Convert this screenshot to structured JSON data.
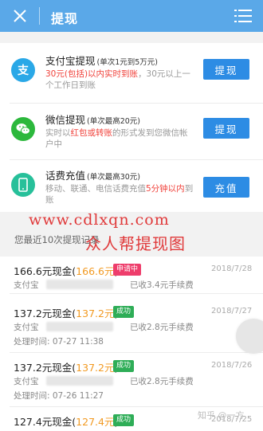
{
  "header": {
    "title": "提现"
  },
  "methods": [
    {
      "name": "支付宝提现",
      "limit": "(单次1元到5万元)",
      "desc_highlight": "30元(包括)以内实时到账",
      "desc_rest": "，30元以上一个工作日到账",
      "button": "提现",
      "icon": "alipay-icon",
      "color": "#2aa8e7"
    },
    {
      "name": "微信提现",
      "limit": "(单次最高20元)",
      "desc_pre": "实时以",
      "desc_highlight": "红包或转账",
      "desc_rest": "的形式发到您微信帐户中",
      "button": "提现",
      "icon": "wechat-icon",
      "color": "#2cb83c"
    },
    {
      "name": "话费充值",
      "limit": "(单次最高30元)",
      "desc_pre": "移动、联通、电信话费充值",
      "desc_highlight": "5分钟以内",
      "desc_rest": "到账",
      "button": "充值",
      "icon": "phone-icon",
      "color": "#27c09a"
    }
  ],
  "watermark": {
    "url": "www.cdlxqn.com",
    "text": "众人帮提现图"
  },
  "recent_title": "您最近10次提现记录",
  "records": [
    {
      "amount": "166.6元现金(",
      "amount_value": "166.6元",
      "amount_close": ")",
      "status": "申请中",
      "status_type": "pending",
      "date": "2018/7/28",
      "account": "支付宝",
      "fee": "已收3.4元手续费",
      "time": ""
    },
    {
      "amount": "137.2元现金(",
      "amount_value": "137.2元",
      "amount_close": ")",
      "status": "成功",
      "status_type": "ok",
      "date": "2018/7/27",
      "account": "支付宝",
      "fee": "已收2.8元手续费",
      "time": "处理时间: 07-27 11:38"
    },
    {
      "amount": "137.2元现金(",
      "amount_value": "137.2元",
      "amount_close": ")",
      "status": "成功",
      "status_type": "ok",
      "date": "2018/7/26",
      "account": "支付宝",
      "fee": "已收2.8元手续费",
      "time": "处理时间: 07-26 11:27"
    },
    {
      "amount": "127.4元现金(",
      "amount_value": "127.4元",
      "amount_close": ")",
      "status": "成功",
      "status_type": "ok",
      "date": "2018/7/25",
      "account": "",
      "fee": "",
      "time": ""
    }
  ],
  "footer_watermark": "知乎 @一方"
}
